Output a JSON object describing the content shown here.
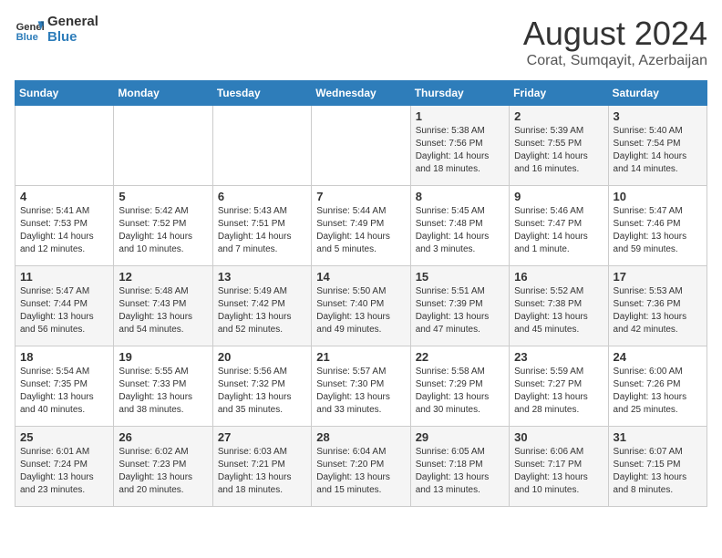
{
  "logo": {
    "line1": "General",
    "line2": "Blue"
  },
  "title": "August 2024",
  "subtitle": "Corat, Sumqayit, Azerbaijan",
  "days_of_week": [
    "Sunday",
    "Monday",
    "Tuesday",
    "Wednesday",
    "Thursday",
    "Friday",
    "Saturday"
  ],
  "weeks": [
    [
      {
        "day": "",
        "content": ""
      },
      {
        "day": "",
        "content": ""
      },
      {
        "day": "",
        "content": ""
      },
      {
        "day": "",
        "content": ""
      },
      {
        "day": "1",
        "content": "Sunrise: 5:38 AM\nSunset: 7:56 PM\nDaylight: 14 hours\nand 18 minutes."
      },
      {
        "day": "2",
        "content": "Sunrise: 5:39 AM\nSunset: 7:55 PM\nDaylight: 14 hours\nand 16 minutes."
      },
      {
        "day": "3",
        "content": "Sunrise: 5:40 AM\nSunset: 7:54 PM\nDaylight: 14 hours\nand 14 minutes."
      }
    ],
    [
      {
        "day": "4",
        "content": "Sunrise: 5:41 AM\nSunset: 7:53 PM\nDaylight: 14 hours\nand 12 minutes."
      },
      {
        "day": "5",
        "content": "Sunrise: 5:42 AM\nSunset: 7:52 PM\nDaylight: 14 hours\nand 10 minutes."
      },
      {
        "day": "6",
        "content": "Sunrise: 5:43 AM\nSunset: 7:51 PM\nDaylight: 14 hours\nand 7 minutes."
      },
      {
        "day": "7",
        "content": "Sunrise: 5:44 AM\nSunset: 7:49 PM\nDaylight: 14 hours\nand 5 minutes."
      },
      {
        "day": "8",
        "content": "Sunrise: 5:45 AM\nSunset: 7:48 PM\nDaylight: 14 hours\nand 3 minutes."
      },
      {
        "day": "9",
        "content": "Sunrise: 5:46 AM\nSunset: 7:47 PM\nDaylight: 14 hours\nand 1 minute."
      },
      {
        "day": "10",
        "content": "Sunrise: 5:47 AM\nSunset: 7:46 PM\nDaylight: 13 hours\nand 59 minutes."
      }
    ],
    [
      {
        "day": "11",
        "content": "Sunrise: 5:47 AM\nSunset: 7:44 PM\nDaylight: 13 hours\nand 56 minutes."
      },
      {
        "day": "12",
        "content": "Sunrise: 5:48 AM\nSunset: 7:43 PM\nDaylight: 13 hours\nand 54 minutes."
      },
      {
        "day": "13",
        "content": "Sunrise: 5:49 AM\nSunset: 7:42 PM\nDaylight: 13 hours\nand 52 minutes."
      },
      {
        "day": "14",
        "content": "Sunrise: 5:50 AM\nSunset: 7:40 PM\nDaylight: 13 hours\nand 49 minutes."
      },
      {
        "day": "15",
        "content": "Sunrise: 5:51 AM\nSunset: 7:39 PM\nDaylight: 13 hours\nand 47 minutes."
      },
      {
        "day": "16",
        "content": "Sunrise: 5:52 AM\nSunset: 7:38 PM\nDaylight: 13 hours\nand 45 minutes."
      },
      {
        "day": "17",
        "content": "Sunrise: 5:53 AM\nSunset: 7:36 PM\nDaylight: 13 hours\nand 42 minutes."
      }
    ],
    [
      {
        "day": "18",
        "content": "Sunrise: 5:54 AM\nSunset: 7:35 PM\nDaylight: 13 hours\nand 40 minutes."
      },
      {
        "day": "19",
        "content": "Sunrise: 5:55 AM\nSunset: 7:33 PM\nDaylight: 13 hours\nand 38 minutes."
      },
      {
        "day": "20",
        "content": "Sunrise: 5:56 AM\nSunset: 7:32 PM\nDaylight: 13 hours\nand 35 minutes."
      },
      {
        "day": "21",
        "content": "Sunrise: 5:57 AM\nSunset: 7:30 PM\nDaylight: 13 hours\nand 33 minutes."
      },
      {
        "day": "22",
        "content": "Sunrise: 5:58 AM\nSunset: 7:29 PM\nDaylight: 13 hours\nand 30 minutes."
      },
      {
        "day": "23",
        "content": "Sunrise: 5:59 AM\nSunset: 7:27 PM\nDaylight: 13 hours\nand 28 minutes."
      },
      {
        "day": "24",
        "content": "Sunrise: 6:00 AM\nSunset: 7:26 PM\nDaylight: 13 hours\nand 25 minutes."
      }
    ],
    [
      {
        "day": "25",
        "content": "Sunrise: 6:01 AM\nSunset: 7:24 PM\nDaylight: 13 hours\nand 23 minutes."
      },
      {
        "day": "26",
        "content": "Sunrise: 6:02 AM\nSunset: 7:23 PM\nDaylight: 13 hours\nand 20 minutes."
      },
      {
        "day": "27",
        "content": "Sunrise: 6:03 AM\nSunset: 7:21 PM\nDaylight: 13 hours\nand 18 minutes."
      },
      {
        "day": "28",
        "content": "Sunrise: 6:04 AM\nSunset: 7:20 PM\nDaylight: 13 hours\nand 15 minutes."
      },
      {
        "day": "29",
        "content": "Sunrise: 6:05 AM\nSunset: 7:18 PM\nDaylight: 13 hours\nand 13 minutes."
      },
      {
        "day": "30",
        "content": "Sunrise: 6:06 AM\nSunset: 7:17 PM\nDaylight: 13 hours\nand 10 minutes."
      },
      {
        "day": "31",
        "content": "Sunrise: 6:07 AM\nSunset: 7:15 PM\nDaylight: 13 hours\nand 8 minutes."
      }
    ]
  ]
}
